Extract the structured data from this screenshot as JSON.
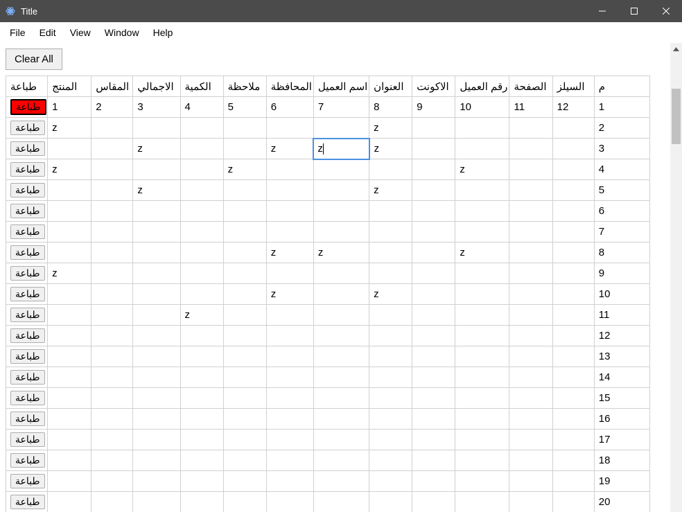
{
  "window": {
    "title": "Title"
  },
  "menubar": {
    "file": "File",
    "edit": "Edit",
    "view": "View",
    "window": "Window",
    "help": "Help"
  },
  "toolbar": {
    "clear_all": "Clear All"
  },
  "table": {
    "headers": {
      "print": "طباعة",
      "product": "المنتج",
      "size": "المقاس",
      "total": "الاجمالي",
      "qty": "الكمية",
      "note": "ملاحظة",
      "gov": "المحافظة",
      "custname": "اسم العميل",
      "address": "العنوان",
      "account": "الاكونت",
      "custno": "رقم العميل",
      "page": "الصفحة",
      "sales": "السيلز",
      "idx": "م"
    },
    "print_label": "طباعة",
    "rows": [
      {
        "idx": "1",
        "red": true,
        "c": [
          "1",
          "2",
          "3",
          "4",
          "5",
          "6",
          "7",
          "8",
          "9",
          "10",
          "11",
          "12"
        ]
      },
      {
        "idx": "2",
        "red": false,
        "c": [
          "z",
          "",
          "",
          "",
          "",
          "",
          "",
          "z",
          "",
          "",
          "",
          ""
        ]
      },
      {
        "idx": "3",
        "red": false,
        "c": [
          "",
          "",
          "z",
          "",
          "",
          "z",
          "z",
          "z",
          "",
          "",
          "",
          ""
        ],
        "editing_col": 6
      },
      {
        "idx": "4",
        "red": false,
        "c": [
          "z",
          "",
          "",
          "",
          "z",
          "",
          "",
          "",
          "",
          "z",
          "",
          ""
        ]
      },
      {
        "idx": "5",
        "red": false,
        "c": [
          "",
          "",
          "z",
          "",
          "",
          "",
          "",
          "z",
          "",
          "",
          "",
          ""
        ]
      },
      {
        "idx": "6",
        "red": false,
        "c": [
          "",
          "",
          "",
          "",
          "",
          "",
          "",
          "",
          "",
          "",
          "",
          ""
        ]
      },
      {
        "idx": "7",
        "red": false,
        "c": [
          "",
          "",
          "",
          "",
          "",
          "",
          "",
          "",
          "",
          "",
          "",
          ""
        ]
      },
      {
        "idx": "8",
        "red": false,
        "c": [
          "",
          "",
          "",
          "",
          "",
          "z",
          "z",
          "",
          "",
          "z",
          "",
          ""
        ]
      },
      {
        "idx": "9",
        "red": false,
        "c": [
          "z",
          "",
          "",
          "",
          "",
          "",
          "",
          "",
          "",
          "",
          "",
          ""
        ]
      },
      {
        "idx": "10",
        "red": false,
        "c": [
          "",
          "",
          "",
          "",
          "",
          "z",
          "",
          "z",
          "",
          "",
          "",
          ""
        ]
      },
      {
        "idx": "11",
        "red": false,
        "c": [
          "",
          "",
          "",
          "z",
          "",
          "",
          "",
          "",
          "",
          "",
          "",
          ""
        ]
      },
      {
        "idx": "12",
        "red": false,
        "c": [
          "",
          "",
          "",
          "",
          "",
          "",
          "",
          "",
          "",
          "",
          "",
          ""
        ]
      },
      {
        "idx": "13",
        "red": false,
        "c": [
          "",
          "",
          "",
          "",
          "",
          "",
          "",
          "",
          "",
          "",
          "",
          ""
        ]
      },
      {
        "idx": "14",
        "red": false,
        "c": [
          "",
          "",
          "",
          "",
          "",
          "",
          "",
          "",
          "",
          "",
          "",
          ""
        ]
      },
      {
        "idx": "15",
        "red": false,
        "c": [
          "",
          "",
          "",
          "",
          "",
          "",
          "",
          "",
          "",
          "",
          "",
          ""
        ]
      },
      {
        "idx": "16",
        "red": false,
        "c": [
          "",
          "",
          "",
          "",
          "",
          "",
          "",
          "",
          "",
          "",
          "",
          ""
        ]
      },
      {
        "idx": "17",
        "red": false,
        "c": [
          "",
          "",
          "",
          "",
          "",
          "",
          "",
          "",
          "",
          "",
          "",
          ""
        ]
      },
      {
        "idx": "18",
        "red": false,
        "c": [
          "",
          "",
          "",
          "",
          "",
          "",
          "",
          "",
          "",
          "",
          "",
          ""
        ]
      },
      {
        "idx": "19",
        "red": false,
        "c": [
          "",
          "",
          "",
          "",
          "",
          "",
          "",
          "",
          "",
          "",
          "",
          ""
        ]
      },
      {
        "idx": "20",
        "red": false,
        "c": [
          "",
          "",
          "",
          "",
          "",
          "",
          "",
          "",
          "",
          "",
          "",
          ""
        ]
      }
    ]
  }
}
